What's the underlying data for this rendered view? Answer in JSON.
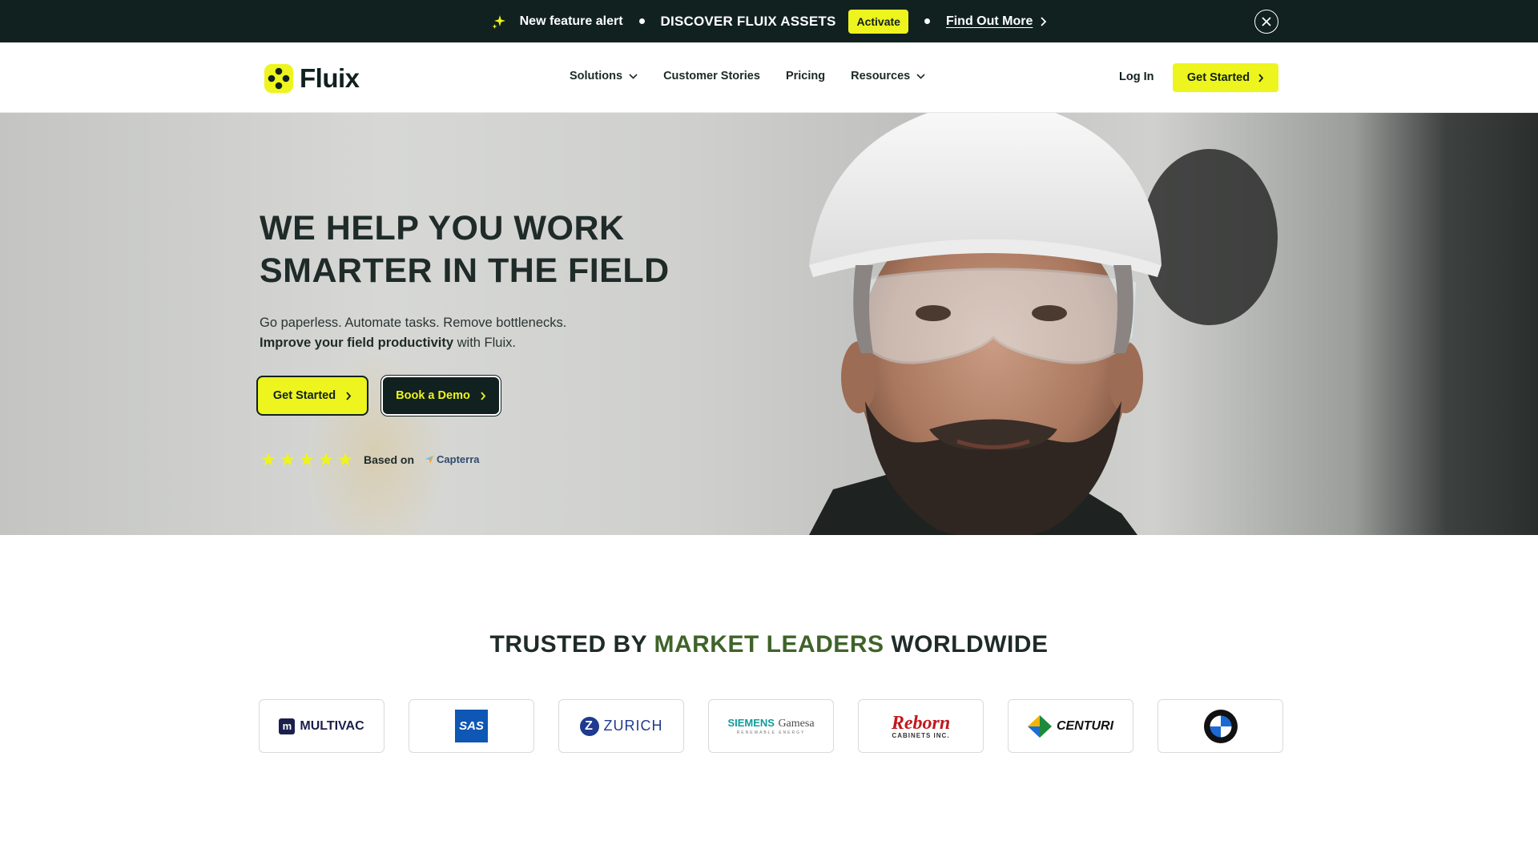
{
  "announcement": {
    "feature_label": "New feature alert",
    "discover_text": "DISCOVER FLUIX ASSETS",
    "activate_label": "Activate",
    "find_more_label": "Find Out More"
  },
  "nav": {
    "brand": "Fluix",
    "menu": [
      {
        "label": "Solutions",
        "has_dropdown": true
      },
      {
        "label": "Customer Stories",
        "has_dropdown": false
      },
      {
        "label": "Pricing",
        "has_dropdown": false
      },
      {
        "label": "Resources",
        "has_dropdown": true
      }
    ],
    "login_label": "Log In",
    "cta_label": "Get Started"
  },
  "hero": {
    "title_line1": "WE HELP YOU WORK",
    "title_line2": "SMARTER IN THE FIELD",
    "subtitle_line1": "Go paperless. Automate tasks. Remove bottlenecks.",
    "subtitle_bold": "Improve your field productivity",
    "subtitle_rest": " with Fluix.",
    "primary_button": "Get Started",
    "secondary_button": "Book a Demo",
    "rating_stars": 5,
    "based_on": "Based on",
    "review_source": "Capterra"
  },
  "trusted": {
    "prefix": "TRUSTED BY ",
    "accent": "MARKET LEADERS",
    "suffix": " WORLDWIDE"
  },
  "customers": [
    {
      "name": "MULTIVAC"
    },
    {
      "name": "SAS"
    },
    {
      "name": "ZURICH"
    },
    {
      "name": "SIEMENS",
      "name2": "Gamesa",
      "tagline": "RENEWABLE ENERGY"
    },
    {
      "name": "Reborn",
      "tagline": "CABINETS INC."
    },
    {
      "name": "CENTURI"
    },
    {
      "name": "BMW"
    }
  ],
  "colors": {
    "brand_yellow": "#eef41d",
    "brand_dark": "#10211f",
    "accent_green": "#3f6329"
  }
}
